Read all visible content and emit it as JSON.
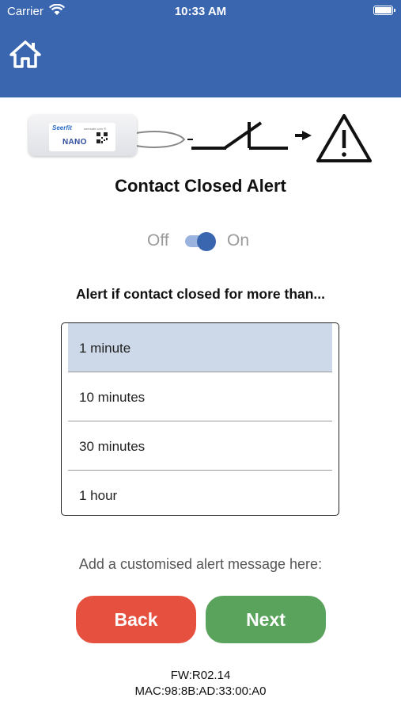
{
  "status_bar": {
    "carrier": "Carrier",
    "time": "10:33 AM"
  },
  "header": {
    "color": "#3a66b0",
    "home_icon": "home-icon"
  },
  "device": {
    "brand": "Seerfit",
    "url": "seersafe.com ®",
    "model": "NANO"
  },
  "title": "Contact Closed Alert",
  "toggle": {
    "off_label": "Off",
    "on_label": "On",
    "state": "on"
  },
  "prompt": "Alert if contact closed for more than...",
  "durations": [
    {
      "label": "1 minute",
      "selected": true
    },
    {
      "label": "10 minutes",
      "selected": false
    },
    {
      "label": "30 minutes",
      "selected": false
    },
    {
      "label": "1 hour",
      "selected": false
    }
  ],
  "custom_message_prompt": "Add a customised alert message here:",
  "buttons": {
    "back": "Back",
    "next": "Next",
    "back_color": "#e5503f",
    "next_color": "#5aa35d"
  },
  "footer": {
    "firmware": "FW:R02.14",
    "mac": "MAC:98:8B:AD:33:00:A0"
  }
}
